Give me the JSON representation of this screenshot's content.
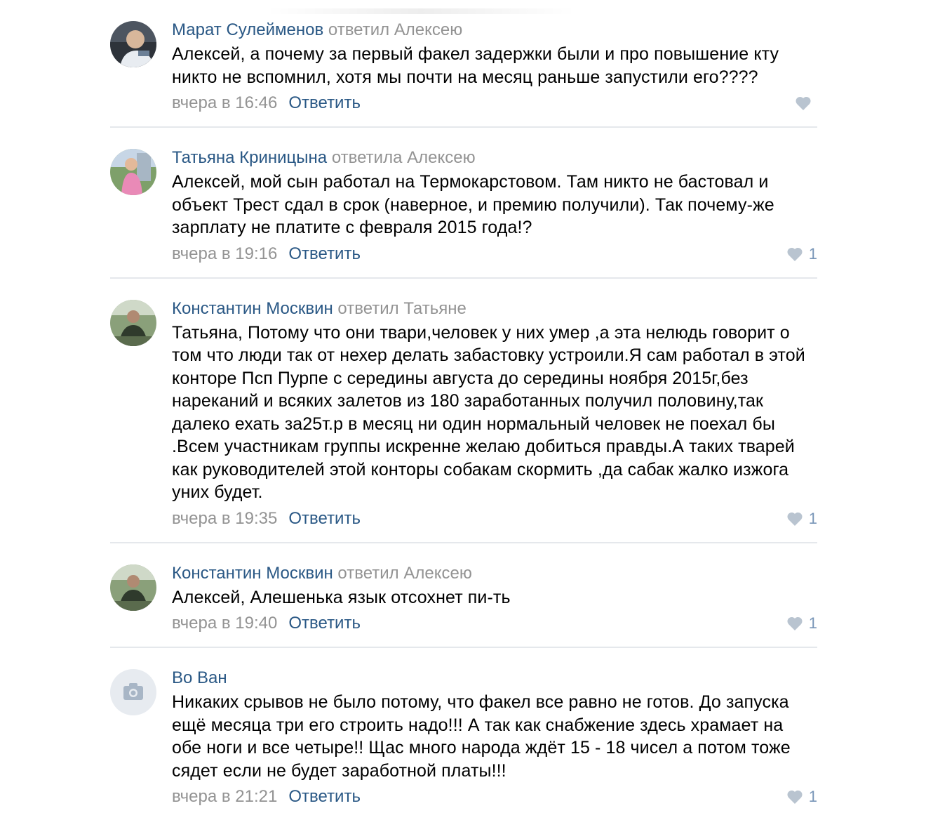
{
  "comments": [
    {
      "author": "Марат Сулейменов",
      "reply_to": "ответил Алексею",
      "text": "Алексей, а почему за первый факел задержки были и про повышение кту никто не вспомнил, хотя мы почти на месяц раньше запустили его????",
      "date": "вчера в 16:46",
      "reply_label": "Ответить",
      "likes": "",
      "avatar_icon": "user-photo"
    },
    {
      "author": "Татьяна Криницына",
      "reply_to": "ответила Алексею",
      "text": "Алексей, мой сын работал на Термокарстовом. Там никто не бастовал и объект Трест сдал в срок (наверное, и премию получили). Так почему-же зарплату не платите с февраля 2015 года!?",
      "date": "вчера в 19:16",
      "reply_label": "Ответить",
      "likes": "1",
      "avatar_icon": "user-photo"
    },
    {
      "author": "Константин Москвин",
      "reply_to": "ответил Татьяне",
      "text": "Татьяна, Потому что они твари,человек у них умер ,а эта нелюдь говорит о том что люди так от нехер делать забастовку устроили.Я сам работал в этой конторе Псп Пурпе с середины августа до середины ноября 2015г,без нареканий и всяких залетов из 180 заработанных получил половину,так далеко ехать за25т.р в месяц ни один нормальный человек не поехал бы .Всем участникам группы искренне желаю добиться правды.А таких тварей как руководителей этой конторы собакам скормить ,да сабак жалко изжога уних будет.",
      "date": "вчера в 19:35",
      "reply_label": "Ответить",
      "likes": "1",
      "avatar_icon": "user-photo"
    },
    {
      "author": "Константин Москвин",
      "reply_to": "ответил Алексею",
      "text": "Алексей, Алешенька язык отсохнет пи-ть",
      "date": "вчера в 19:40",
      "reply_label": "Ответить",
      "likes": "1",
      "avatar_icon": "user-photo"
    },
    {
      "author": "Во Ван",
      "reply_to": "",
      "text": "Никаких срывов не было потому, что факел все равно не готов. До запуска ещё месяца три его строить надо!!! А так как снабжение здесь храмает на обе ноги и все четыре!! Щас много народа ждёт 15 - 18 чисел а потом тоже сядет если не будет заработной платы!!!",
      "date": "вчера в 21:21",
      "reply_label": "Ответить",
      "likes": "1",
      "avatar_icon": "camera-icon"
    }
  ],
  "colors": {
    "author": "#2a5885",
    "muted": "#939393",
    "divider": "#e5e8ec",
    "like_icon": "#b9c4d0"
  }
}
